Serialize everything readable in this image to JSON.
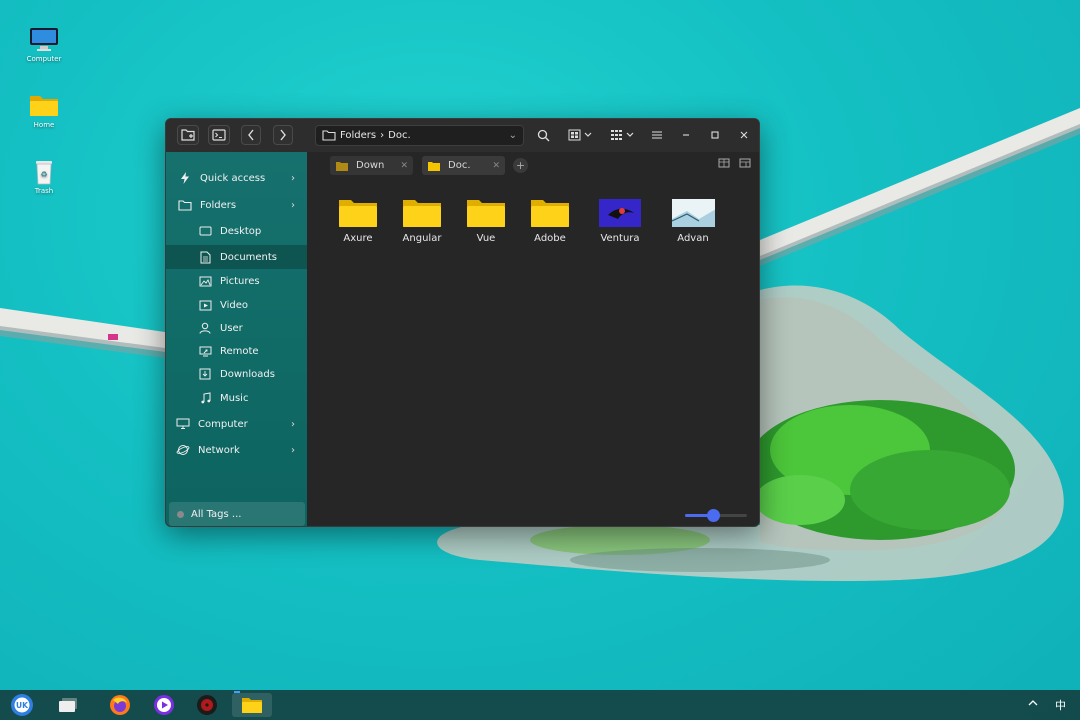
{
  "desktop": {
    "icons": [
      {
        "label": "Computer",
        "icon": "monitor-icon"
      },
      {
        "label": "Home",
        "icon": "folder-icon"
      },
      {
        "label": "Trash",
        "icon": "trash-icon"
      }
    ]
  },
  "window": {
    "toolbar": {
      "new_folder_icon": "new-folder-icon",
      "terminal_icon": "terminal-icon",
      "back_icon": "chevron-left-icon",
      "forward_icon": "chevron-right-icon",
      "search_icon": "search-icon",
      "view_mode_icon": "icon-view-icon",
      "sort_icon": "grid-sort-icon",
      "menu_icon": "hamburger-menu-icon",
      "minimize_icon": "minimize-icon",
      "maximize_icon": "maximize-icon",
      "close_icon": "close-icon"
    },
    "path": {
      "root": "Folders",
      "separator": "›",
      "current": "Doc."
    },
    "sidebar": {
      "items": [
        {
          "label": "Quick access",
          "icon": "lightning-icon",
          "expandable": true
        },
        {
          "label": "Folders",
          "icon": "folder-outline-icon",
          "expandable": true
        },
        {
          "label": "Desktop",
          "icon": "desktop-icon",
          "expandable": false
        },
        {
          "label": "Documents",
          "icon": "document-icon",
          "expandable": false,
          "active": true
        },
        {
          "label": "Pictures",
          "icon": "picture-icon",
          "expandable": false
        },
        {
          "label": "Video",
          "icon": "video-icon",
          "expandable": false
        },
        {
          "label": "User",
          "icon": "user-icon",
          "expandable": false
        },
        {
          "label": "Remote",
          "icon": "remote-icon",
          "expandable": false
        },
        {
          "label": "Downloads",
          "icon": "download-icon",
          "expandable": false
        },
        {
          "label": "Music",
          "icon": "music-icon",
          "expandable": false
        },
        {
          "label": "Computer",
          "icon": "computer-icon",
          "expandable": true
        },
        {
          "label": "Network",
          "icon": "network-icon",
          "expandable": true
        }
      ],
      "tags_label": "All Tags ..."
    },
    "tabs": [
      {
        "label": "Down",
        "active": false
      },
      {
        "label": "Doc.",
        "active": true
      }
    ],
    "files": [
      {
        "name": "Axure",
        "type": "folder"
      },
      {
        "name": "Angular",
        "type": "folder"
      },
      {
        "name": "Vue",
        "type": "folder"
      },
      {
        "name": "Adobe",
        "type": "folder"
      },
      {
        "name": "Ventura",
        "type": "image"
      },
      {
        "name": "Advan",
        "type": "image"
      }
    ],
    "zoom_level": 0.45
  },
  "taskbar": {
    "apps": [
      {
        "name": "start-menu-icon"
      },
      {
        "name": "multitask-view-icon"
      },
      {
        "name": "firefox-icon"
      },
      {
        "name": "media-player-icon"
      },
      {
        "name": "music-disc-icon"
      },
      {
        "name": "file-manager-icon",
        "active": true
      }
    ],
    "tray": {
      "expand_icon": "chevron-up-icon",
      "ime": "中"
    }
  },
  "colors": {
    "sidebar": "#106a66",
    "folder": "#f7c600",
    "accent": "#4b6cf0",
    "window_bg": "#262626"
  }
}
